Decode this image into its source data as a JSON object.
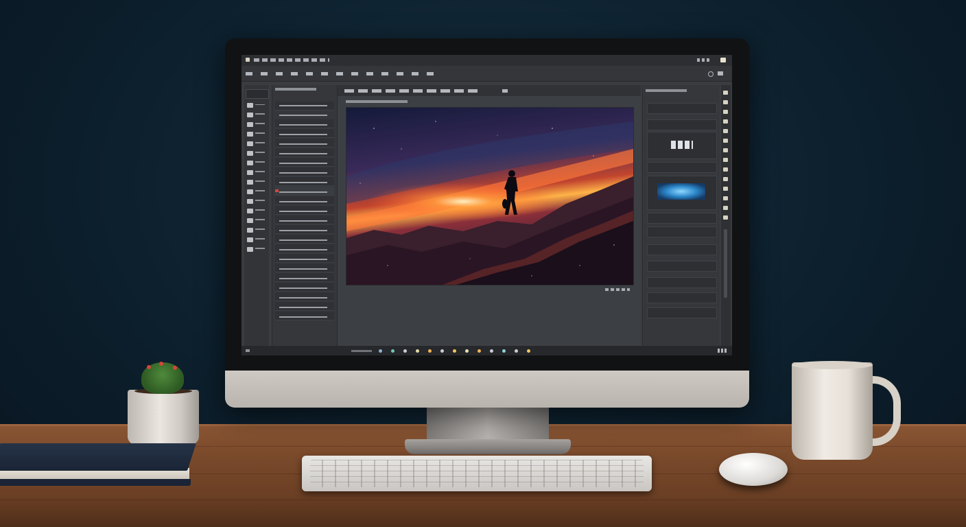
{
  "scene": {
    "objects": [
      "monitor",
      "keyboard",
      "mouse",
      "coffee-mug",
      "potted-cactus",
      "notebook",
      "desk"
    ]
  },
  "app": {
    "canvas_image": "space-sunset-astronaut"
  },
  "colors": {
    "wall": "#0e2230",
    "desk": "#7a4a2b",
    "ui_dark": "#3a3c3f",
    "accent_orange": "#ff8a3c"
  }
}
